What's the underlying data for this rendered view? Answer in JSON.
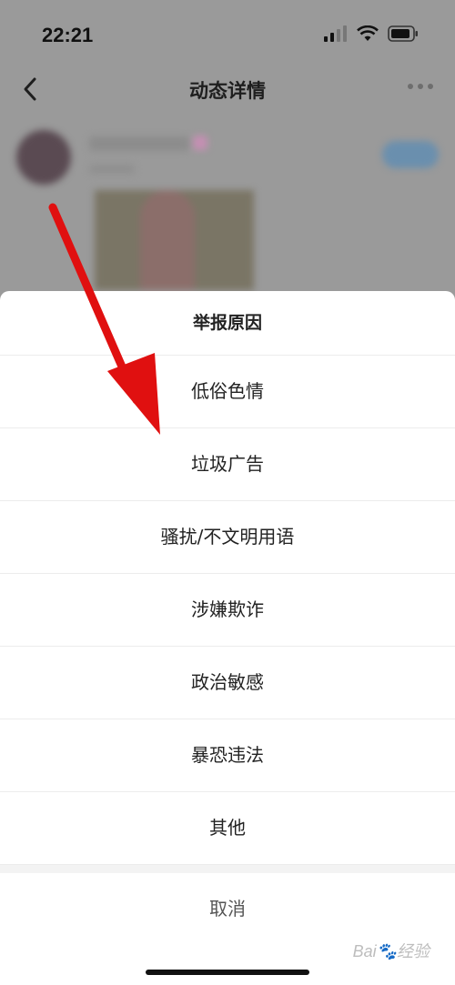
{
  "status_bar": {
    "time": "22:21"
  },
  "nav": {
    "title": "动态详情"
  },
  "sheet": {
    "title": "举报原因",
    "options": [
      "低俗色情",
      "垃圾广告",
      "骚扰/不文明用语",
      "涉嫌欺诈",
      "政治敏感",
      "暴恐违法",
      "其他"
    ],
    "cancel": "取消"
  },
  "colors": {
    "arrow": "#e01010",
    "overlay": "#9a9a9a",
    "sheet_bg": "#ffffff"
  }
}
